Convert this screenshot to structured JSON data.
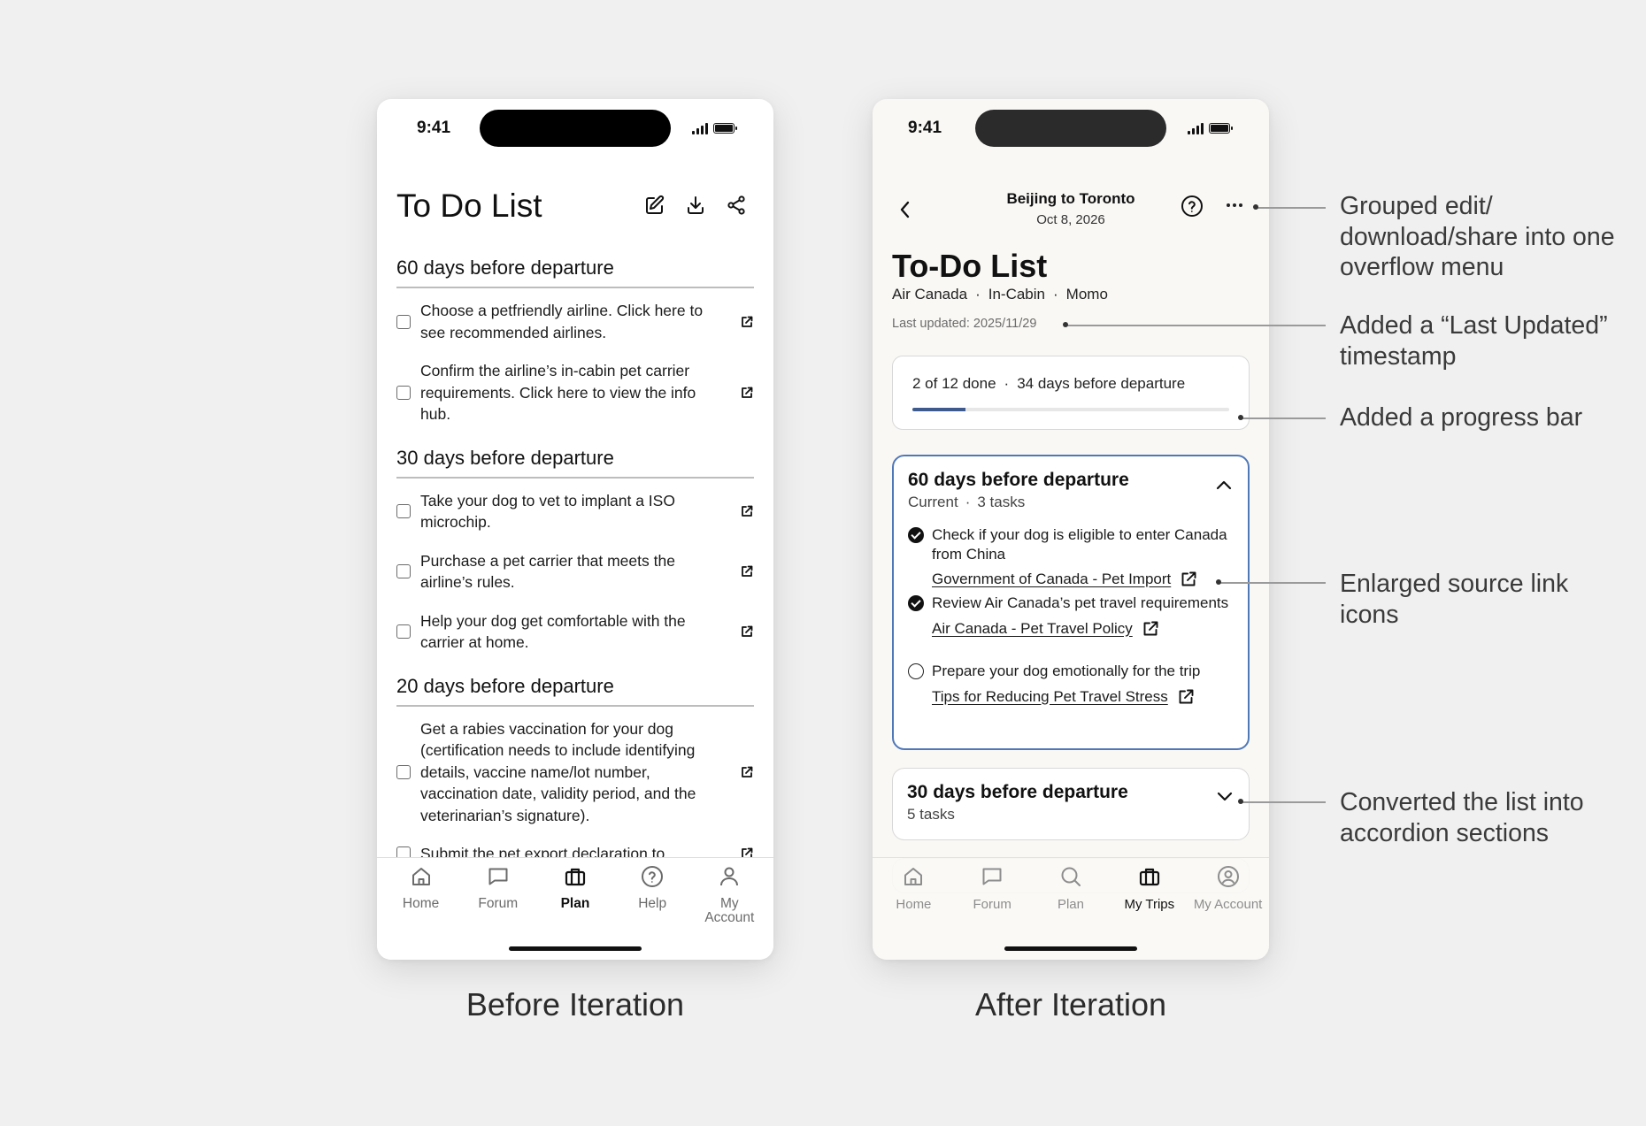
{
  "status": {
    "time": "9:41"
  },
  "before": {
    "title": "To Do List",
    "header_icons": [
      "edit-icon",
      "download-icon",
      "share-icon"
    ],
    "sections": [
      {
        "title": "60 days before departure",
        "tasks": [
          "Choose a petfriendly airline. Click here to see recommended airlines.",
          "Confirm the airline’s in-cabin pet carrier requirements. Click here to view the info hub."
        ]
      },
      {
        "title": "30 days before departure",
        "tasks": [
          "Take your dog to vet to implant a ISO microchip.",
          "Purchase a pet carrier that meets the airline’s rules.",
          "Help your dog get comfortable with the carrier at home."
        ]
      },
      {
        "title": "20 days before departure",
        "tasks": [
          "Get a rabies vaccination for your dog (certification needs to include identifying details, vaccine name/lot number, vaccination date, validity period, and the veterinarian’s signature).",
          "Submit the pet export declaration to"
        ]
      }
    ],
    "tabs": [
      {
        "label": "Home",
        "icon": "home-icon"
      },
      {
        "label": "Forum",
        "icon": "chat-icon"
      },
      {
        "label": "Plan",
        "icon": "briefcase-icon",
        "active": true
      },
      {
        "label": "Help",
        "icon": "help-icon"
      },
      {
        "label": "My Account",
        "icon": "user-icon"
      }
    ]
  },
  "after": {
    "route": "Beijing to Toronto",
    "date": "Oct 8, 2026",
    "title": "To-Do List",
    "meta": [
      "Air Canada",
      "·",
      "In-Cabin",
      "·",
      "Momo"
    ],
    "updated": "Last updated: 2025/11/29",
    "progress": {
      "done_text": "2 of 12 done",
      "sep": "·",
      "days_text": "34 days before departure",
      "fraction": 0.1667
    },
    "open_section": {
      "title": "60 days before departure",
      "status": "Current",
      "sep": "·",
      "count": "3 tasks",
      "tasks": [
        {
          "text": "Check if your dog is eligible to enter Canada from China",
          "done": true,
          "link": "Government of Canada - Pet Import"
        },
        {
          "text": "Review Air Canada’s pet travel requirements",
          "done": true,
          "link": "Air Canada - Pet Travel Policy"
        },
        {
          "text": "Prepare your dog emotionally for the trip",
          "done": false,
          "link": "Tips for Reducing Pet Travel Stress"
        }
      ]
    },
    "closed_section": {
      "title": "30 days before departure",
      "count": "5 tasks"
    },
    "tabs": [
      {
        "label": "Home",
        "icon": "home-icon"
      },
      {
        "label": "Forum",
        "icon": "chat-icon"
      },
      {
        "label": "Plan",
        "icon": "search-icon"
      },
      {
        "label": "My Trips",
        "icon": "briefcase-icon",
        "active": true
      },
      {
        "label": "My Account",
        "icon": "account-circle-icon"
      }
    ]
  },
  "captions": {
    "before": "Before Iteration",
    "after": "After Iteration"
  },
  "annotations": [
    {
      "text": "Grouped edit/ download/share into one overflow menu"
    },
    {
      "text": "Added a “Last Updated” timestamp"
    },
    {
      "text": "Added a progress bar"
    },
    {
      "text": "Enlarged source link icons"
    },
    {
      "text": "Converted the list into accordion sections"
    }
  ]
}
